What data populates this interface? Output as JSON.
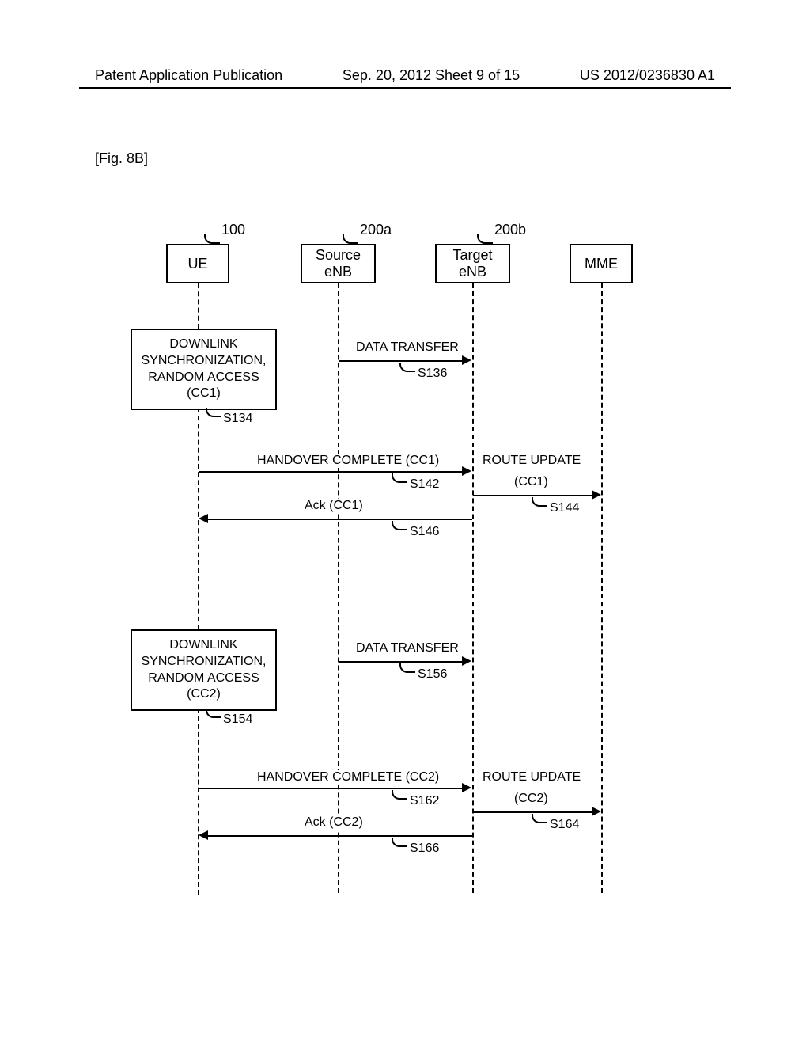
{
  "header": {
    "left": "Patent Application Publication",
    "mid": "Sep. 20, 2012  Sheet 9 of 15",
    "right": "US 2012/0236830 A1"
  },
  "figure_label": "[Fig. 8B]",
  "entities": {
    "ue": {
      "label": "UE",
      "ref": "100"
    },
    "source": {
      "label1": "Source",
      "label2": "eNB",
      "ref": "200a"
    },
    "target": {
      "label1": "Target",
      "label2": "eNB",
      "ref": "200b"
    },
    "mme": {
      "label": "MME"
    }
  },
  "processes": {
    "sync1": {
      "line1": "DOWNLINK",
      "line2": "SYNCHRONIZATION,",
      "line3": "RANDOM ACCESS",
      "line4": "(CC1)",
      "ref": "S134"
    },
    "sync2": {
      "line1": "DOWNLINK",
      "line2": "SYNCHRONIZATION,",
      "line3": "RANDOM ACCESS",
      "line4": "(CC2)",
      "ref": "S154"
    }
  },
  "messages": {
    "dt1": {
      "label": "DATA TRANSFER",
      "ref": "S136"
    },
    "hc1": {
      "label": "HANDOVER COMPLETE (CC1)",
      "ref": "S142"
    },
    "ru1": {
      "label1": "ROUTE UPDATE",
      "label2": "(CC1)",
      "ref": "S144"
    },
    "ack1": {
      "label": "Ack (CC1)",
      "ref": "S146"
    },
    "dt2": {
      "label": "DATA TRANSFER",
      "ref": "S156"
    },
    "hc2": {
      "label": "HANDOVER COMPLETE (CC2)",
      "ref": "S162"
    },
    "ru2": {
      "label1": "ROUTE UPDATE",
      "label2": "(CC2)",
      "ref": "S164"
    },
    "ack2": {
      "label": "Ack (CC2)",
      "ref": "S166"
    }
  }
}
